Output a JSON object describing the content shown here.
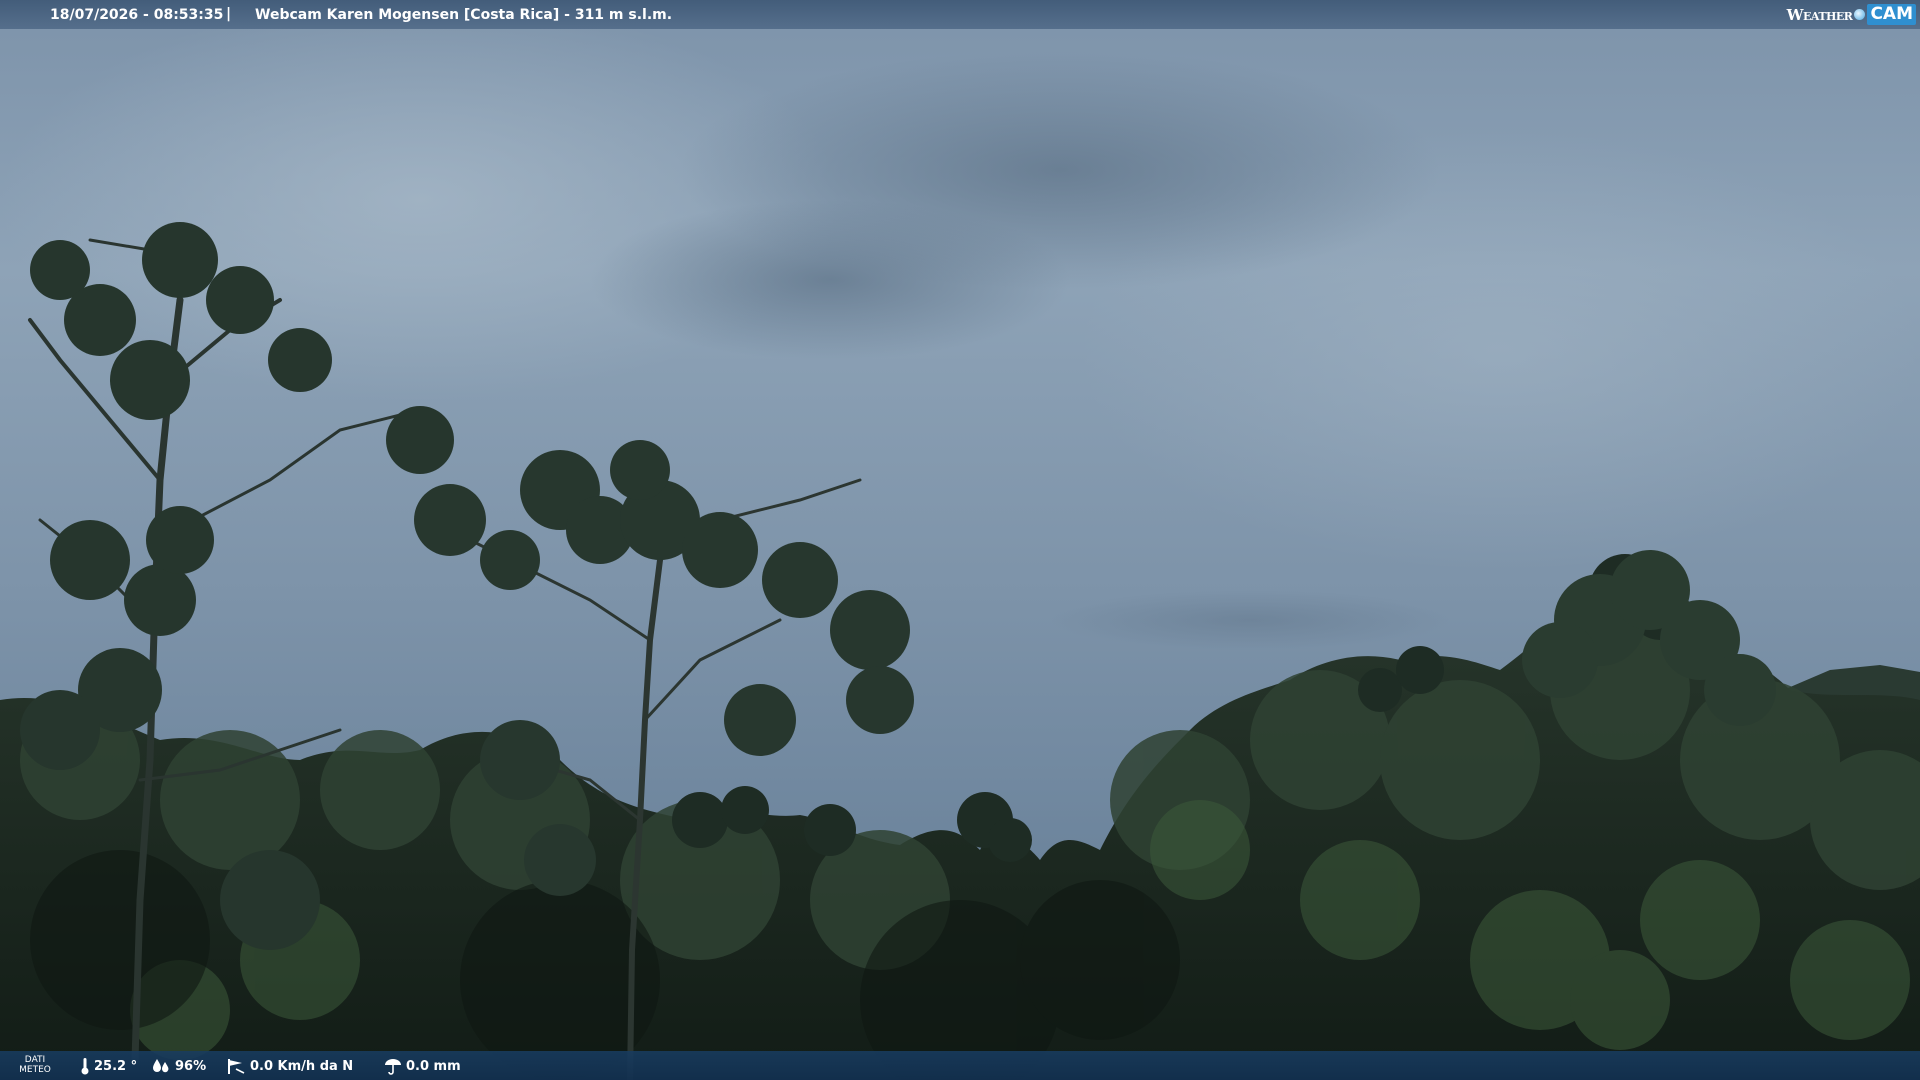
{
  "header": {
    "timestamp": "18/07/2026 - 08:53:35",
    "separator": "|",
    "title": "Webcam Karen Mogensen [Costa Rica]  - 311 m s.l.m."
  },
  "logo": {
    "weather": "Weather",
    "cam": "CAM"
  },
  "weather_bar": {
    "label_line1": "DATI",
    "label_line2": "METEO",
    "temperature": "25.2 °",
    "humidity": "96%",
    "wind": "0.0 Km/h da N",
    "rain": "0.0 mm",
    "icons": [
      "thermometer-icon",
      "humidity-icon",
      "wind-icon",
      "rain-icon"
    ]
  },
  "colors": {
    "sky_top": "#8fa3b7",
    "sky_bottom": "#6f87a0",
    "foliage": "#1c2a22",
    "bar_top": "#3e5876",
    "bar_bottom": "#183c60"
  }
}
